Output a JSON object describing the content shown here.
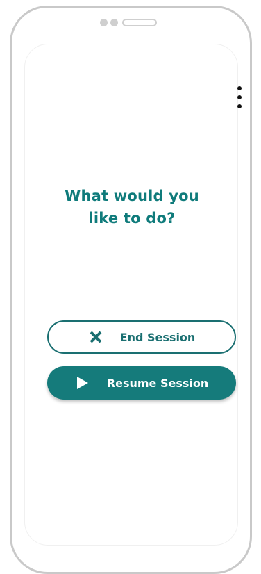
{
  "screen": {
    "title_line1": "What would you",
    "title_line2": "like to do?"
  },
  "actions": {
    "end_label": "End Session",
    "resume_label": "Resume Session"
  },
  "icons": {
    "menu": "more-vertical-icon",
    "end": "close-icon",
    "resume": "play-icon"
  },
  "colors": {
    "accent": "#157b7b",
    "title": "#0f7b7b"
  }
}
